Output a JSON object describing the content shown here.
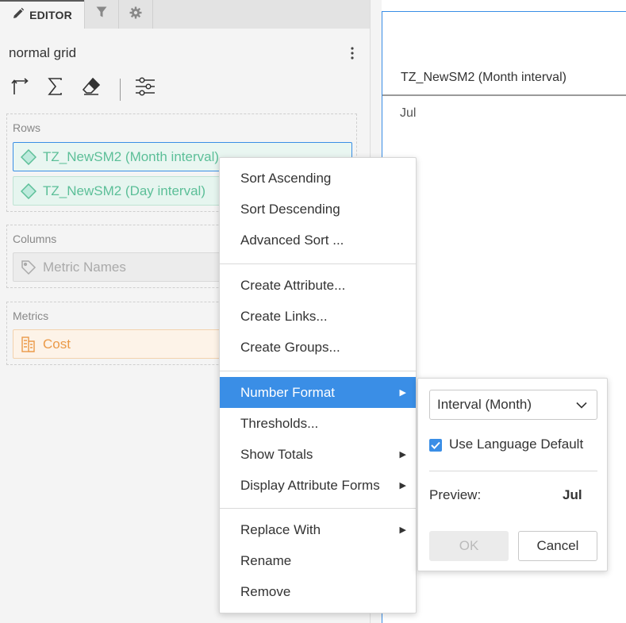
{
  "editor": {
    "tabs": [
      {
        "label": "EDITOR",
        "icon": "pencil-icon"
      },
      {
        "label": "",
        "icon": "filter-icon"
      },
      {
        "label": "",
        "icon": "gear-icon"
      }
    ],
    "viz_title": "normal grid",
    "toolbar": [
      "swap-axes-icon",
      "sigma-icon",
      "eraser-icon",
      "sliders-icon"
    ],
    "zones": {
      "rows": {
        "label": "Rows",
        "items": [
          "TZ_NewSM2 (Month interval)",
          "TZ_NewSM2 (Day interval)"
        ]
      },
      "columns": {
        "label": "Columns",
        "items": [
          "Metric Names"
        ]
      },
      "metrics": {
        "label": "Metrics",
        "items": [
          "Cost"
        ]
      }
    }
  },
  "grid": {
    "header": "TZ_NewSM2 (Month interval)",
    "cells": [
      "Jul"
    ]
  },
  "context_menu": {
    "items": [
      {
        "label": "Sort Ascending"
      },
      {
        "label": "Sort Descending"
      },
      {
        "label": "Advanced Sort ..."
      },
      {
        "label": "Create Attribute..."
      },
      {
        "label": "Create Links..."
      },
      {
        "label": "Create Groups..."
      },
      {
        "label": "Number Format",
        "submenu": true,
        "highlighted": true
      },
      {
        "label": "Thresholds..."
      },
      {
        "label": "Show Totals",
        "submenu": true
      },
      {
        "label": "Display Attribute Forms",
        "submenu": true
      },
      {
        "label": "Replace With",
        "submenu": true
      },
      {
        "label": "Rename"
      },
      {
        "label": "Remove"
      }
    ],
    "arrow_glyph": "▶"
  },
  "number_format": {
    "selected_format": "Interval (Month)",
    "use_language_default_label": "Use Language Default",
    "use_language_default_checked": true,
    "preview_label": "Preview:",
    "preview_value": "Jul",
    "ok_label": "OK",
    "cancel_label": "Cancel"
  },
  "colors": {
    "accent": "#3a8ee6",
    "attribute": "#5cbf98",
    "metric": "#eb9a48",
    "panel_bg": "#f4f4f4"
  }
}
